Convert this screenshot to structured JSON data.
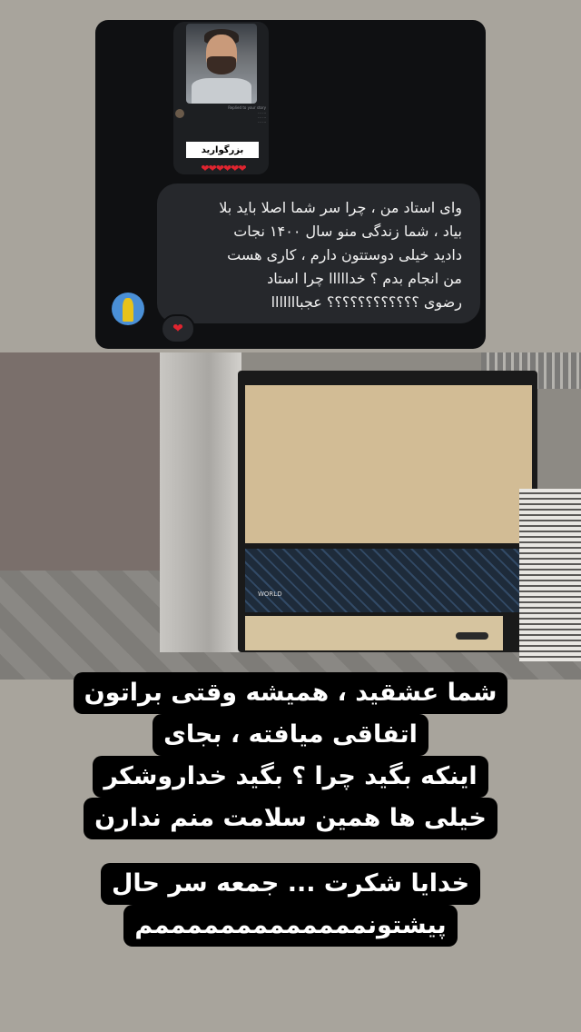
{
  "dm": {
    "shared_post": {
      "caption_lines": [
        "Replied to your story",
        "... ...",
        "... ...",
        "... ..."
      ],
      "label": "بزرگوارید",
      "hearts": "❤❤❤❤❤❤"
    },
    "reply_text": "وای استاد من ، چرا سر شما اصلا باید بلا\nبیاد ، شما زندگی منو سال ۱۴۰۰ نجات\nدادید خیلی دوستتون دارم ، کاری هست\nمن انجام بدم ؟ خدااااا چرا استاد\nرضوی ؟؟؟؟؟؟؟؟؟؟؟؟ عجبااااااا",
    "reaction": "❤"
  },
  "photo": {
    "heater_brand": "WORLD"
  },
  "captions": {
    "block1": [
      "شما عشقید ، همیشه وقتی براتون",
      "اتفاقی میافته ، بجای",
      "اینکه بگید چرا ؟ بگید خداروشکر",
      "خیلی ها همین سلامت منم ندارن"
    ],
    "block2": [
      "خدایا شکرت ... جمعه سر حال",
      "پیشتونمممممممممممممم"
    ]
  },
  "colors": {
    "background": "#a8a49c",
    "dm_card": "#0f1012",
    "bubble": "#26282c",
    "heart": "#e0242f"
  }
}
